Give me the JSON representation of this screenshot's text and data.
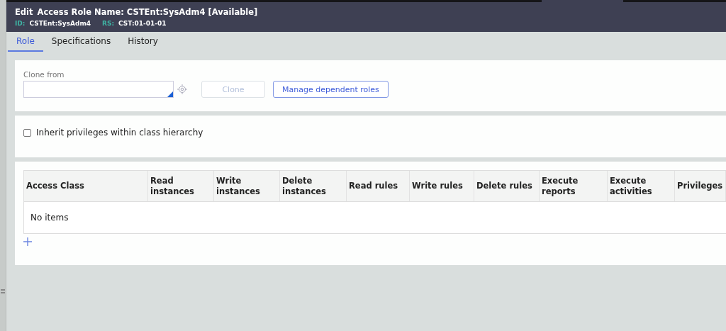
{
  "header": {
    "action": "Edit",
    "title": "Access Role Name: CSTEnt:SysAdm4 [Available]",
    "meta": [
      {
        "label": "ID:",
        "value": "CSTEnt:SysAdm4"
      },
      {
        "label": "RS:",
        "value": "CST:01-01-01"
      }
    ]
  },
  "tabs": [
    {
      "label": "Role",
      "selected": true
    },
    {
      "label": "Specifications",
      "selected": false
    },
    {
      "label": "History",
      "selected": false
    }
  ],
  "clone": {
    "label": "Clone from",
    "clone_button": {
      "label": "Clone",
      "disabled": true
    },
    "manage_button": {
      "label": "Manage dependent roles",
      "disabled": false
    }
  },
  "inherit": {
    "label": "Inherit privileges within class hierarchy",
    "checked": false
  },
  "table": {
    "columns": [
      "Access Class",
      "Read instances",
      "Write instances",
      "Delete instances",
      "Read rules",
      "Write rules",
      "Delete rules",
      "Execute reports",
      "Execute activities",
      "Privileges"
    ],
    "empty_text": "No items"
  }
}
